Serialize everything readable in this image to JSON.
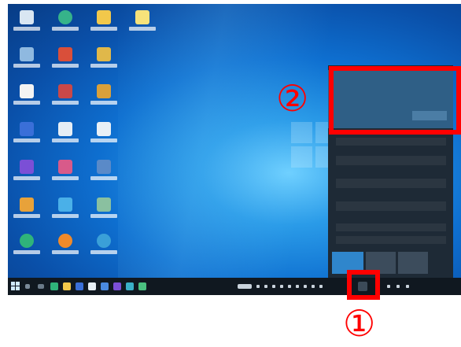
{
  "annotations": {
    "marker_1": "①",
    "marker_2": "②"
  },
  "taskbar": {
    "clock": ""
  },
  "colors": {
    "highlight": "#ff0000",
    "desktop": "#0e6fd0",
    "taskbar": "#101820",
    "action_center": "#1e2a36",
    "toast": "#2f5f86"
  },
  "icons": [
    "recycle-bin-icon",
    "edge-icon",
    "folder-icon",
    "file-icon",
    "settings-icon",
    "app-icon",
    "windows-start-icon",
    "action-center-icon"
  ]
}
